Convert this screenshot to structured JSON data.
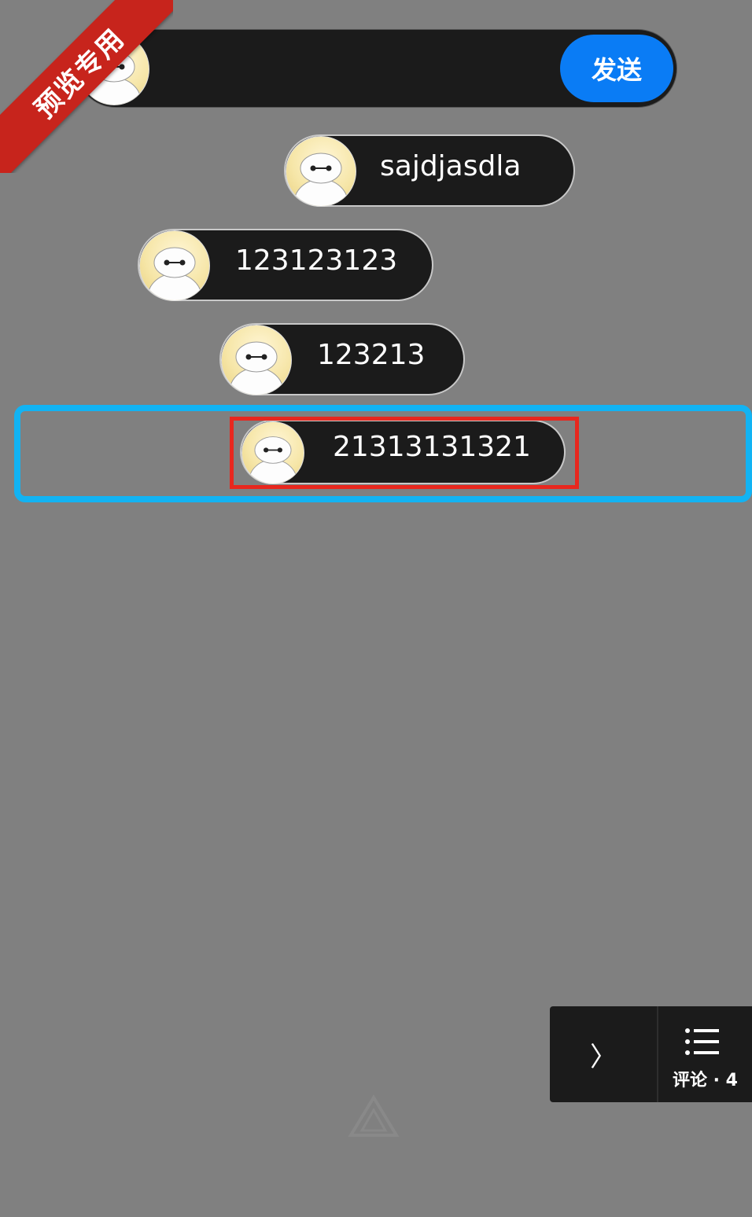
{
  "watermark": {
    "ribbon_text": "预览专用"
  },
  "input_bar": {
    "value": "",
    "placeholder": "",
    "send_label": "发送"
  },
  "comments": [
    {
      "text": "sajdjasdla"
    },
    {
      "text": "123123123"
    },
    {
      "text": "123213"
    },
    {
      "text": "21313131321"
    }
  ],
  "bottom_panel": {
    "next_symbol": "〉",
    "comments_label": "评论 · 4"
  },
  "colors": {
    "background": "#808080",
    "bubble": "#1b1b1b",
    "send_button": "#0a7cf5",
    "ribbon": "#c7241c",
    "highlight_outer": "#12b3f3",
    "highlight_inner": "#e8271e"
  }
}
